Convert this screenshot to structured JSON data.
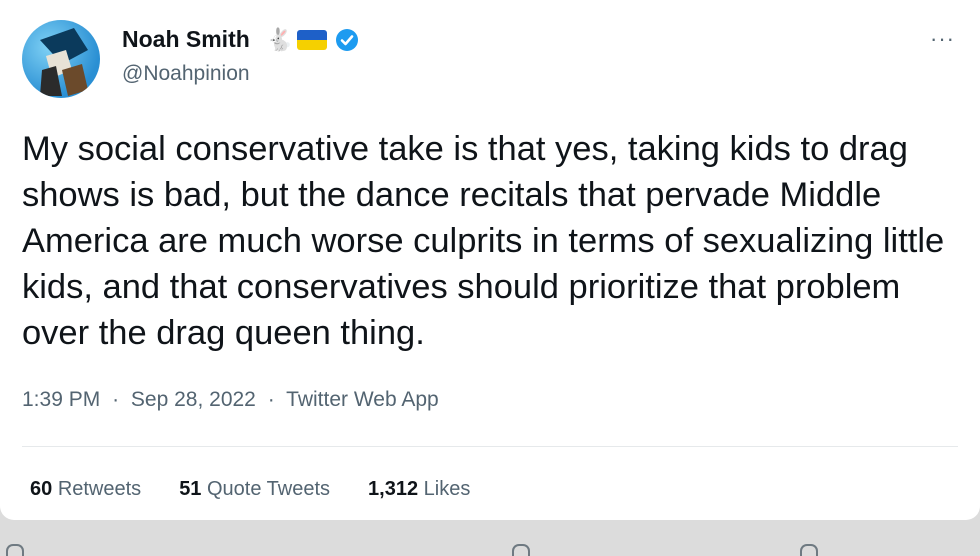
{
  "author": {
    "name": "Noah Smith",
    "handle": "@Noahpinion",
    "name_emojis": [
      "rabbit-icon",
      "ukraine-flag-icon",
      "verified-badge-icon"
    ]
  },
  "tweet": {
    "text": "My social conservative take is that yes, taking kids to drag shows is bad, but the dance recitals that pervade Middle America are much worse culprits in terms of sexualizing little kids, and that conservatives should prioritize that problem over the drag queen thing.",
    "time": "1:39 PM",
    "date": "Sep 28, 2022",
    "source": "Twitter Web App",
    "separator": "·"
  },
  "stats": {
    "retweets_count": "60",
    "retweets_label": "Retweets",
    "quote_tweets_count": "51",
    "quote_tweets_label": "Quote Tweets",
    "likes_count": "1,312",
    "likes_label": "Likes"
  },
  "menu": {
    "more_label": "···"
  },
  "colors": {
    "text_primary": "#0f1419",
    "text_secondary": "#536471",
    "verified_blue": "#1d9bf0",
    "flag_blue": "#1e60c8",
    "flag_yellow": "#f5d000"
  }
}
